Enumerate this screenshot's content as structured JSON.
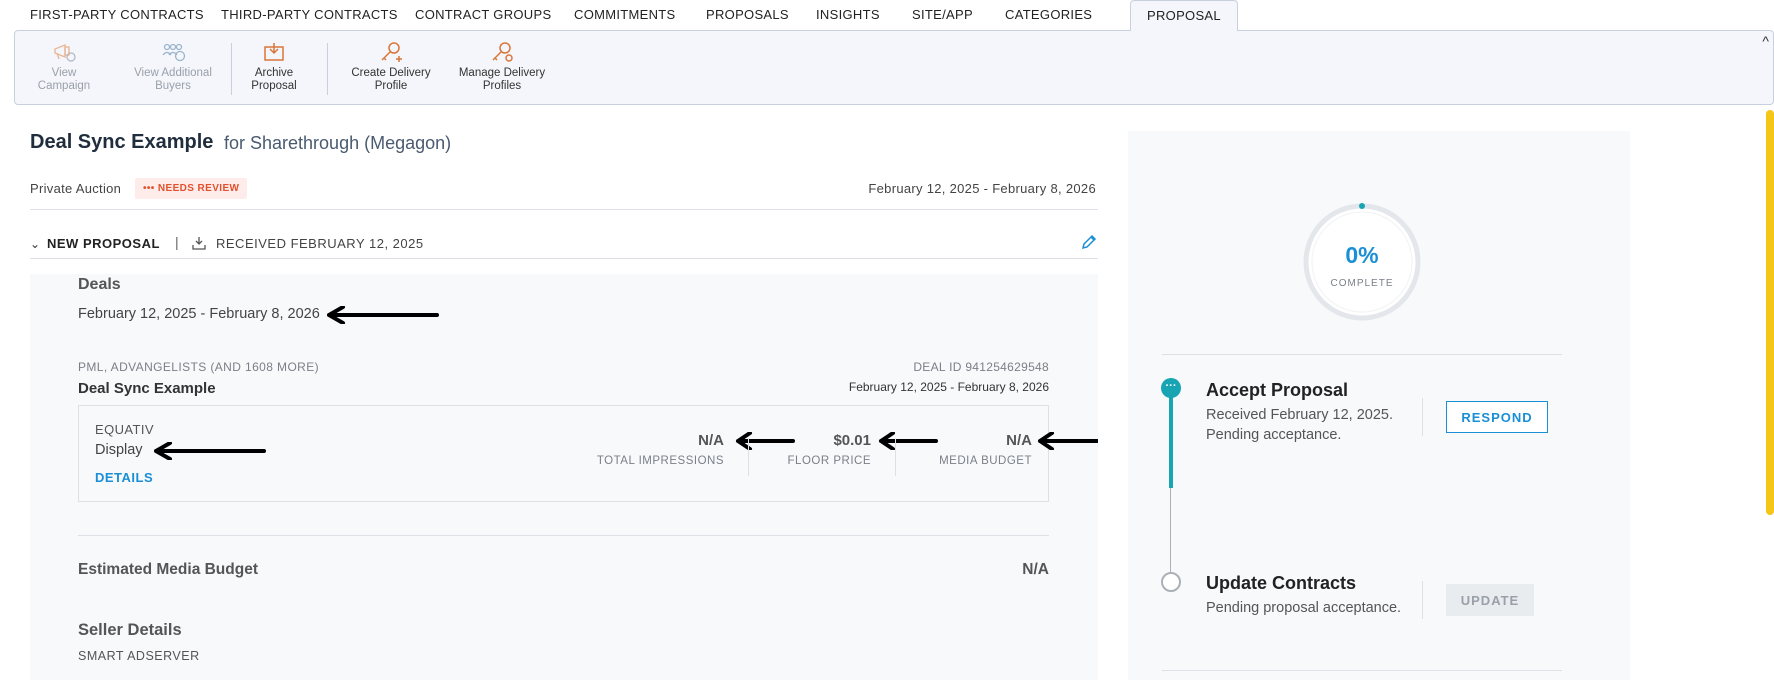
{
  "tabs": [
    {
      "label": "FIRST-PARTY CONTRACTS"
    },
    {
      "label": "THIRD-PARTY CONTRACTS"
    },
    {
      "label": "CONTRACT GROUPS"
    },
    {
      "label": "COMMITMENTS"
    },
    {
      "label": "PROPOSALS"
    },
    {
      "label": "INSIGHTS"
    },
    {
      "label": "SITE/APP"
    },
    {
      "label": "CATEGORIES"
    },
    {
      "label": "PROPOSAL"
    }
  ],
  "active_tab": "PROPOSAL",
  "ribbon": {
    "view_campaign": {
      "line1": "View",
      "line2": "Campaign",
      "icon": "megaphone-icon"
    },
    "view_buyers": {
      "line1": "View Additional",
      "line2": "Buyers",
      "icon": "group-clock-icon"
    },
    "archive": {
      "line1": "Archive",
      "line2": "Proposal",
      "icon": "archive-box-icon"
    },
    "create_profile": {
      "line1": "Create Delivery",
      "line2": "Profile",
      "icon": "key-add-icon"
    },
    "manage_profiles": {
      "line1": "Manage Delivery",
      "line2": "Profiles",
      "icon": "key-gear-icon"
    },
    "collapse_glyph": "^"
  },
  "proposal": {
    "title": "Deal Sync Example",
    "subtitle": "for Sharethrough (Megagon)",
    "type": "Private Auction",
    "status_badge": "••• NEEDS REVIEW",
    "date_range": "February 12, 2025 - February 8, 2026",
    "section_label": "NEW PROPOSAL",
    "received": "RECEIVED FEBRUARY 12, 2025"
  },
  "deals": {
    "heading": "Deals",
    "date_range": "February 12, 2025 - February 8, 2026",
    "sources": "PML, ADVANGELISTS (AND 1608 MORE)",
    "deal_id": "DEAL ID 941254629548",
    "name": "Deal Sync Example",
    "deal_range": "February 12, 2025 - February 8, 2026",
    "ssp": "EQUATIV",
    "format": "Display",
    "details_link": "DETAILS",
    "metrics": {
      "impressions": {
        "value": "N/A",
        "label": "TOTAL IMPRESSIONS"
      },
      "floor": {
        "value": "$0.01",
        "label": "FLOOR PRICE"
      },
      "budget": {
        "value": "N/A",
        "label": "MEDIA BUDGET"
      }
    }
  },
  "estimated_budget": {
    "label": "Estimated Media Budget",
    "value": "N/A"
  },
  "seller": {
    "heading": "Seller Details",
    "value": "SMART ADSERVER"
  },
  "progress": {
    "percent_text": "0%",
    "label": "COMPLETE",
    "fraction": 0.0
  },
  "steps": {
    "accept": {
      "title": "Accept Proposal",
      "desc": "Received February 12, 2025. Pending acceptance.",
      "button": "RESPOND"
    },
    "update": {
      "title": "Update Contracts",
      "desc": "Pending proposal acceptance.",
      "button": "UPDATE"
    }
  },
  "colors": {
    "accent_blue": "#1a8fd6",
    "teal": "#17a4b3",
    "badge_red": "#e0522d",
    "scroll_yellow": "#f5c518",
    "icon_orange": "#d9763a"
  }
}
